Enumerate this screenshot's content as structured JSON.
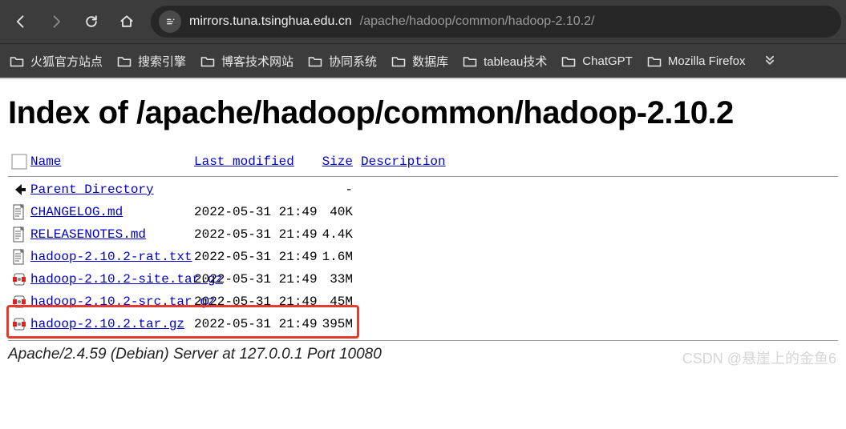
{
  "browser": {
    "url_host": "mirrors.tuna.tsinghua.edu.cn",
    "url_path": "/apache/hadoop/common/hadoop-2.10.2/",
    "bookmarks": [
      "火狐官方站点",
      "搜索引擎",
      "博客技术网站",
      "协同系统",
      "数据库",
      "tableau技术",
      "ChatGPT",
      "Mozilla Firefox"
    ]
  },
  "page": {
    "title": "Index of /apache/hadoop/common/hadoop-2.10.2",
    "columns": {
      "name": "Name",
      "lastmod": "Last modified",
      "size": "Size",
      "desc": "Description"
    },
    "rows": [
      {
        "icon": "back",
        "name": "Parent Directory",
        "lastmod": "",
        "size": "-",
        "link": true
      },
      {
        "icon": "text",
        "name": "CHANGELOG.md",
        "lastmod": "2022-05-31 21:49",
        "size": "40K",
        "link": true
      },
      {
        "icon": "text",
        "name": "RELEASENOTES.md",
        "lastmod": "2022-05-31 21:49",
        "size": "4.4K",
        "link": true
      },
      {
        "icon": "text",
        "name": "hadoop-2.10.2-rat.txt",
        "lastmod": "2022-05-31 21:49",
        "size": "1.6M",
        "link": true
      },
      {
        "icon": "archive",
        "name": "hadoop-2.10.2-site.tar.gz",
        "lastmod": "2022-05-31 21:49",
        "size": "33M",
        "link": true
      },
      {
        "icon": "archive",
        "name": "hadoop-2.10.2-src.tar.gz",
        "lastmod": "2022-05-31 21:49",
        "size": "45M",
        "link": true
      },
      {
        "icon": "archive",
        "name": "hadoop-2.10.2.tar.gz",
        "lastmod": "2022-05-31 21:49",
        "size": "395M",
        "link": true,
        "highlighted": true
      }
    ],
    "server_line": "Apache/2.4.59 (Debian) Server at 127.0.0.1 Port 10080"
  },
  "watermark": "CSDN @悬崖上的金鱼6"
}
